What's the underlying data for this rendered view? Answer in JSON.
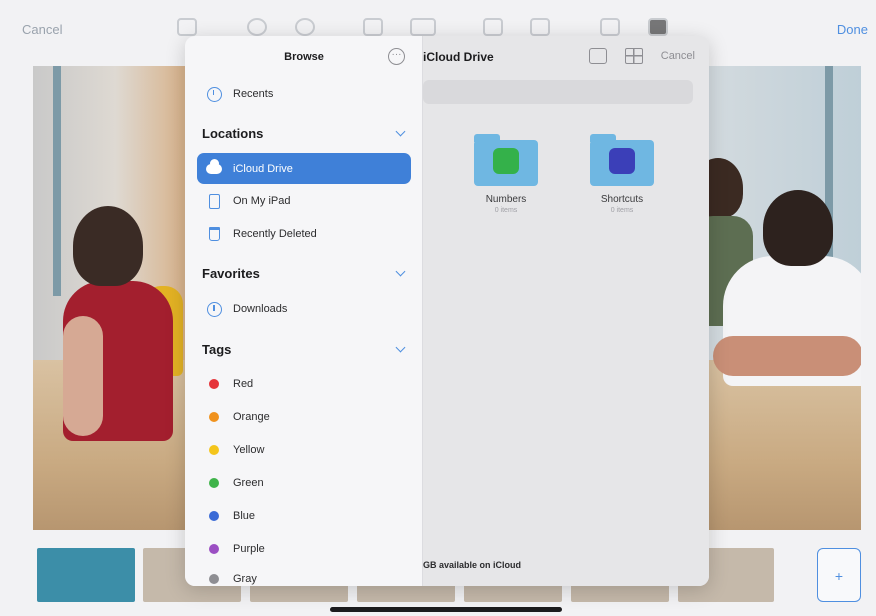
{
  "background_app": {
    "cancel_label": "Cancel",
    "done_label": "Done",
    "add_slide_label": "+"
  },
  "browser": {
    "sidebar_title": "Browse",
    "more_icon": "ellipsis-circle-icon",
    "recents_label": "Recents",
    "locations": {
      "header": "Locations",
      "items": [
        {
          "label": "iCloud Drive",
          "icon": "cloud-icon",
          "selected": true
        },
        {
          "label": "On My iPad",
          "icon": "ipad-icon",
          "selected": false
        },
        {
          "label": "Recently Deleted",
          "icon": "trash-icon",
          "selected": false
        }
      ]
    },
    "favorites": {
      "header": "Favorites",
      "items": [
        {
          "label": "Downloads",
          "icon": "download-circle-icon"
        }
      ]
    },
    "tags": {
      "header": "Tags",
      "items": [
        {
          "label": "Red",
          "color": "#e5343a"
        },
        {
          "label": "Orange",
          "color": "#f0921e"
        },
        {
          "label": "Yellow",
          "color": "#f4c51c"
        },
        {
          "label": "Green",
          "color": "#3fb34a"
        },
        {
          "label": "Blue",
          "color": "#3a6ad6"
        },
        {
          "label": "Purple",
          "color": "#9b4fc3"
        },
        {
          "label": "Gray",
          "color": "#8e8e93"
        }
      ]
    },
    "detail": {
      "title": "iCloud Drive",
      "cancel_label": "Cancel",
      "folders": [
        {
          "name": "Numbers",
          "subtitle": "0 items",
          "badge_color": "#34b14a",
          "icon": "numbers-app-icon"
        },
        {
          "name": "Shortcuts",
          "subtitle": "0 items",
          "badge_color": "#3b3fb8",
          "icon": "shortcuts-app-icon"
        }
      ],
      "storage_note": "GB available on iCloud"
    }
  },
  "colors": {
    "accent": "#3f80d8",
    "link": "#4f8fe0"
  }
}
